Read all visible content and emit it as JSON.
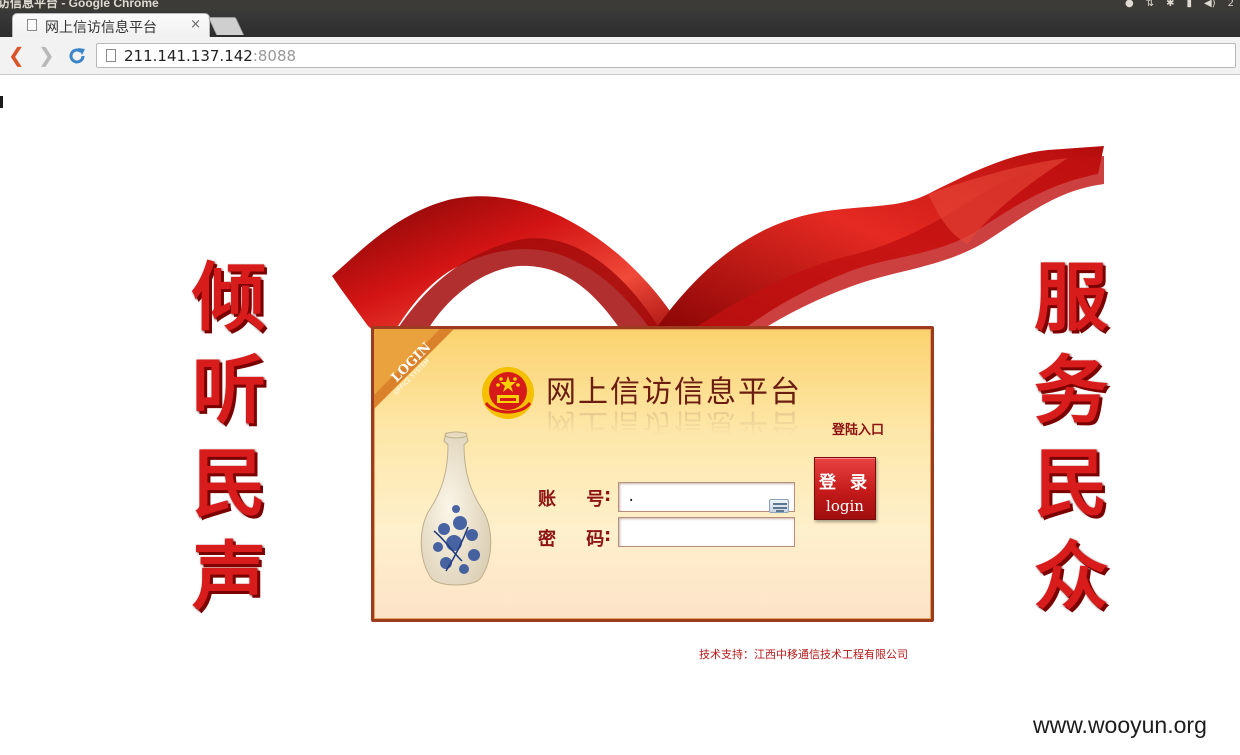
{
  "window": {
    "title": "访信息平台 - Google Chrome",
    "tray_clock": "2"
  },
  "browser": {
    "tab_title": "网上信访信息平台",
    "tab_close": "×",
    "url_host": "211.141.137.142",
    "url_port": ":8088"
  },
  "page": {
    "left_slogan": [
      "倾",
      "听",
      "民",
      "声"
    ],
    "right_slogan": [
      "服",
      "务",
      "民",
      "众"
    ],
    "corner_badge": {
      "main": "LOGIN",
      "sub": "OFFICE SYSTEM"
    },
    "platform_title": "网上信访信息平台",
    "entry_label": "登陆入口",
    "username_label": "账 号",
    "password_label": "密 码",
    "colon": ":",
    "username_value": ".",
    "password_value": "",
    "login_button_zh": "登 录",
    "login_button_en": "login",
    "support_text": "技术支持：江西中移通信技术工程有限公司",
    "watermark": "www.wooyun.org"
  },
  "colors": {
    "slogan_red": "#d81b1b",
    "panel_border": "#9c3b1e",
    "button_red": "#c41a1a",
    "label_red": "#8e1313"
  }
}
